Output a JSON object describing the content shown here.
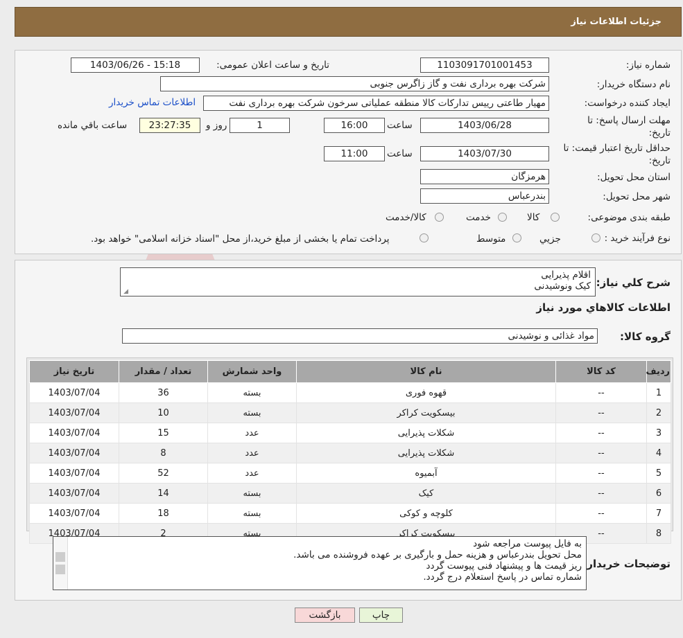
{
  "header": {
    "title": "جزئیات اطلاعات نیاز"
  },
  "form": {
    "need_number_label": "شماره نیاز:",
    "need_number": "1103091701001453",
    "announce_label": "تاریخ و ساعت اعلان عمومی:",
    "announce_value": "1403/06/26 - 15:18",
    "buyer_org_label": "نام دستگاه خریدار:",
    "buyer_org": "شرکت بهره برداری نفت و گاز زاگرس جنوبی",
    "creator_label": "ایجاد کننده درخواست:",
    "creator": "مهیار  طاعتی رییس تدارکات کالا منطقه عملیاتی سرخون شرکت بهره برداری نفت",
    "contact_link": "اطلاعات تماس خریدار",
    "deadline_label_1": "مهلت ارسال پاسخ: تا",
    "deadline_label_2": "تاریخ:",
    "deadline_date": "1403/06/28",
    "time_label": "ساعت",
    "deadline_time": "16:00",
    "days_value": "1",
    "days_label": "روز و",
    "remaining_time": "23:27:35",
    "remaining_label": "ساعت باقي مانده",
    "validity_label_1": "حداقل تاریخ اعتبار قیمت: تا",
    "validity_label_2": "تاریخ:",
    "validity_date": "1403/07/30",
    "validity_time": "11:00",
    "province_label": "استان محل تحویل:",
    "province": "هرمزگان",
    "city_label": "شهر محل تحویل:",
    "city": "بندرعباس",
    "category_label": "طبقه بندی موضوعی:",
    "category_options": [
      "کالا",
      "خدمت",
      "کالا/خدمت"
    ],
    "process_label": "نوع فرآیند خرید :",
    "process_options": [
      "جزیي",
      "متوسط"
    ],
    "process_note": "پرداخت تمام یا بخشی از مبلغ خرید،از محل \"اسناد خزانه اسلامی\" خواهد بود."
  },
  "details": {
    "summary_label": "شرح کلي نياز:",
    "summary_lines": [
      "اقلام پذیرایی",
      "کیک ونوشیدنی"
    ],
    "goods_info_title": "اطلاعات کالاهاي مورد نياز",
    "goods_group_label": "گروه کالا:",
    "goods_group": "مواد غذائی و نوشیدنی"
  },
  "table": {
    "headers": [
      "ردیف",
      "کد کالا",
      "نام کالا",
      "واحد شمارش",
      "تعداد / مقدار",
      "تاریخ نیاز"
    ],
    "rows": [
      [
        "1",
        "--",
        "قهوه فوری",
        "بسته",
        "36",
        "1403/07/04"
      ],
      [
        "2",
        "--",
        "بیسکویت کراکر",
        "بسته",
        "10",
        "1403/07/04"
      ],
      [
        "3",
        "--",
        "شکلات پذیرایی",
        "عدد",
        "15",
        "1403/07/04"
      ],
      [
        "4",
        "--",
        "شکلات پذیرایی",
        "عدد",
        "8",
        "1403/07/04"
      ],
      [
        "5",
        "--",
        "آبمیوه",
        "عدد",
        "52",
        "1403/07/04"
      ],
      [
        "6",
        "--",
        "کیک",
        "بسته",
        "14",
        "1403/07/04"
      ],
      [
        "7",
        "--",
        "کلوچه و کوکی",
        "بسته",
        "18",
        "1403/07/04"
      ],
      [
        "8",
        "--",
        "بیسکویت کراکر",
        "بسته",
        "2",
        "1403/07/04"
      ]
    ]
  },
  "buyer_notes": {
    "label": "توضیحات خریدار:",
    "lines": [
      "به فایل پیوست مراجعه شود",
      "محل تحویل  بندرعباس و هزینه حمل و بارگیری  بر عهده فروشنده می باشد.",
      "ریز قیمت ها و پیشنهاد فنی پیوست گردد",
      "شماره تماس در پاسخ استعلام درج گردد."
    ]
  },
  "buttons": {
    "print": "چاپ",
    "back": "بازگشت"
  },
  "watermark": "AriaTender.neT",
  "colors": {
    "header_bg": "#8f6d41",
    "link": "#1a4ec8",
    "print_btn": "#e8f5d8",
    "back_btn": "#f8d8d8",
    "table_header": "#a8a8a8"
  }
}
